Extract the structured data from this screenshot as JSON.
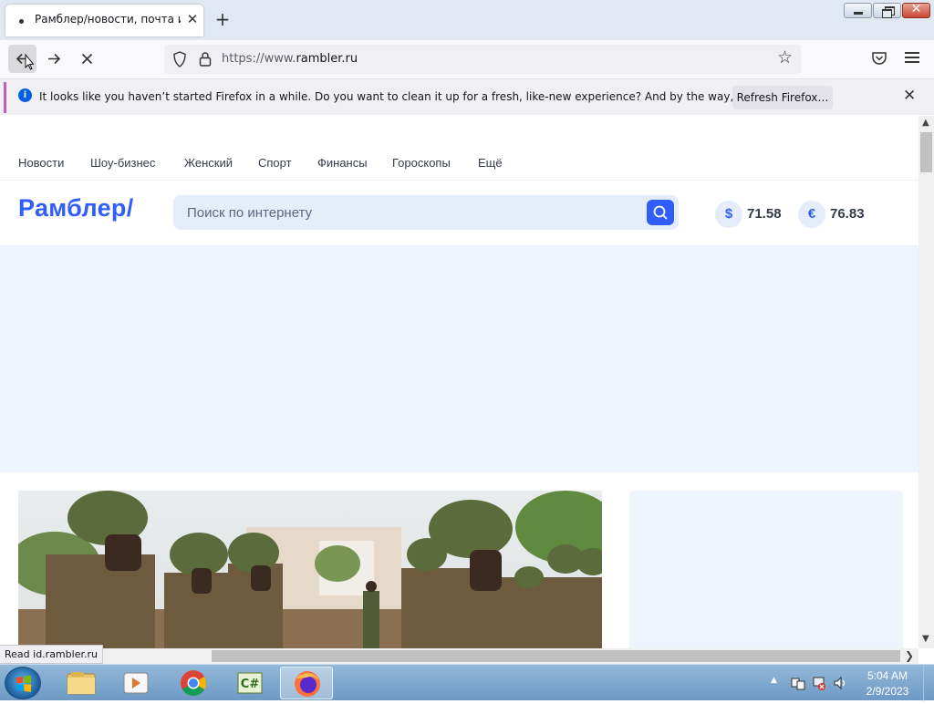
{
  "browser": {
    "tab_title": "Рамблер/новости, почта и поиск",
    "url_prefix": "https://www.",
    "url_domain": "rambler.ru",
    "notification": {
      "message": "It looks like you haven’t started Firefox in a while. Do you want to clean it up for a fresh, like-new experience? And by the way, welcome back!",
      "refresh_label": "Refresh Firefox…"
    },
    "status_text": "Read id.rambler.ru"
  },
  "page": {
    "topnav": [
      "Новости",
      "Шоу-бизнес",
      "Женский",
      "Спорт",
      "Финансы",
      "Гороскопы",
      "Ещё"
    ],
    "logo": "Рамблер/",
    "search_placeholder": "Поиск по интернету",
    "rates": {
      "usd_symbol": "$",
      "usd_value": "71.58",
      "eur_symbol": "€",
      "eur_value": "76.83"
    }
  },
  "taskbar": {
    "time": "5:04 AM",
    "date": "2/9/2023",
    "apps": [
      "explorer-icon",
      "media-player-icon",
      "chrome-icon",
      "csharp-icon",
      "firefox-icon"
    ]
  },
  "colors": {
    "brand": "#315efb",
    "search_bg": "#e5edfb",
    "ad_bg": "#eef4fe"
  }
}
